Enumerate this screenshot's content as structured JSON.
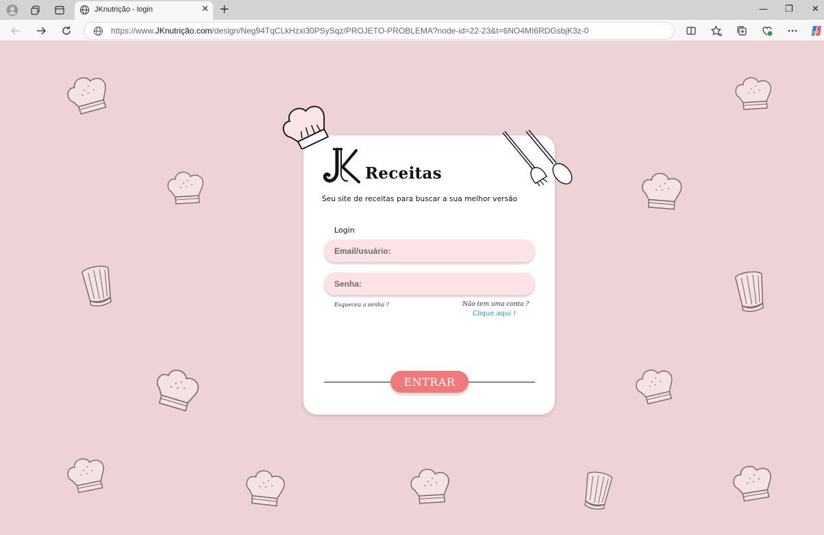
{
  "browser": {
    "tab_title": "JKnutrição - login",
    "url_prefix": "https://www.",
    "url_domain": "JKnutrição.com",
    "url_path": "/design/Neg94TqCLkHzxi30PSySqz/PROJETO-PROBLEMA?node-id=22-23&t=6NO4MI6RDGsbjK3z-0",
    "tab_close": "✕",
    "new_tab": "+",
    "minimize": "—",
    "restore": "❐",
    "close": "✕"
  },
  "brand": {
    "logo_letters": "JK",
    "name": "Receitas",
    "tagline": "Seu site de receitas para buscar a sua melhor versão"
  },
  "login": {
    "title": "Login",
    "email_placeholder": "Email/usuário:",
    "password_placeholder": "Senha:",
    "forgot_password": "Esqueceu a senha ?",
    "no_account": "Não tem uma conta ?",
    "click_here": "Clique aqui !",
    "submit_label": "ENTRAR"
  },
  "colors": {
    "page_bg": "#eed3d6",
    "field_bg": "#fde3e6",
    "button_bg": "#f07a7a",
    "link": "#1aa5d6"
  }
}
